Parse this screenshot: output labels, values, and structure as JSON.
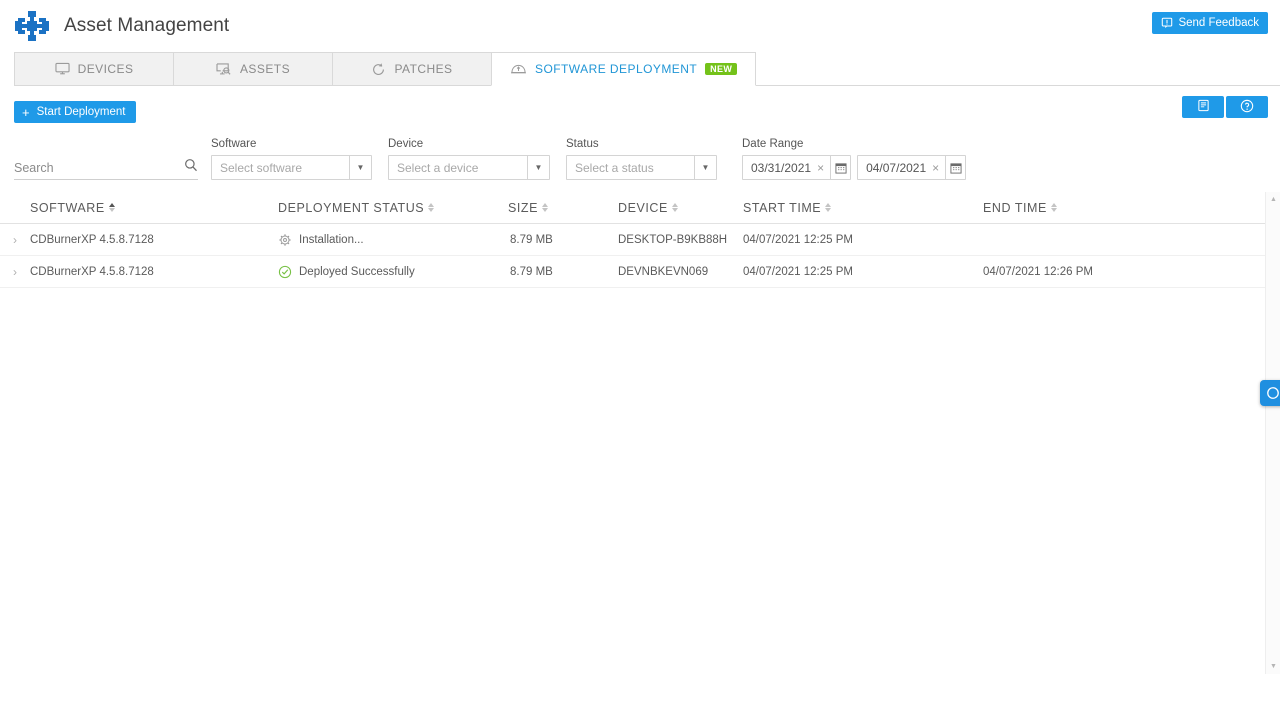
{
  "header": {
    "title": "Asset Management",
    "logo_icon": "grid-puzzle-logo",
    "feedback_label": "Send Feedback",
    "feedback_icon": "feedback-icon"
  },
  "tabs": [
    {
      "label": "DEVICES",
      "icon": "monitor-icon",
      "active": false,
      "badge": ""
    },
    {
      "label": "ASSETS",
      "icon": "monitor-search-icon",
      "active": false,
      "badge": ""
    },
    {
      "label": "PATCHES",
      "icon": "refresh-icon",
      "active": false,
      "badge": ""
    },
    {
      "label": "SOFTWARE DEPLOYMENT",
      "icon": "cloud-deploy-icon",
      "active": true,
      "badge": "NEW"
    }
  ],
  "toolbar": {
    "start_deployment_label": "Start Deployment",
    "plus_glyph": "+",
    "icon_buttons": [
      {
        "icon": "book-icon",
        "name": "documentation-button"
      },
      {
        "icon": "help-circle-icon",
        "name": "help-button"
      }
    ]
  },
  "filters": {
    "search": {
      "label": "Search",
      "placeholder": "Search",
      "value": "",
      "icon": "search-icon"
    },
    "software": {
      "label": "Software",
      "placeholder": "Select software",
      "value": ""
    },
    "device": {
      "label": "Device",
      "placeholder": "Select a device",
      "value": ""
    },
    "status": {
      "label": "Status",
      "placeholder": "Select a status",
      "value": ""
    },
    "date_range": {
      "label": "Date Range",
      "from": "03/31/2021",
      "to": "04/07/2021",
      "clear_glyph": "×",
      "calendar_icon": "calendar-icon"
    }
  },
  "table": {
    "columns": [
      {
        "label": "SOFTWARE",
        "sort": "asc"
      },
      {
        "label": "DEPLOYMENT STATUS",
        "sort": "none"
      },
      {
        "label": "SIZE",
        "sort": "none"
      },
      {
        "label": "DEVICE",
        "sort": "none"
      },
      {
        "label": "START TIME",
        "sort": "none"
      },
      {
        "label": "END TIME",
        "sort": "none"
      }
    ],
    "rows": [
      {
        "expander": "›",
        "software": "CDBurnerXP 4.5.8.7128",
        "status": "Installation...",
        "status_icon": "gear-icon",
        "status_color": "#9b9b9b",
        "size": "8.79 MB",
        "device": "DESKTOP-B9KB88H",
        "start_time": "04/07/2021 12:25 PM",
        "end_time": ""
      },
      {
        "expander": "›",
        "software": "CDBurnerXP 4.5.8.7128",
        "status": "Deployed Successfully",
        "status_icon": "check-circle-icon",
        "status_color": "#76c043",
        "size": "8.79 MB",
        "device": "DEVNBKEVN069",
        "start_time": "04/07/2021 12:25 PM",
        "end_time": "04/07/2021 12:26 PM"
      }
    ]
  },
  "colors": {
    "accent": "#1f9ae8",
    "tab_active_text": "#2196d6",
    "badge_new": "#74c21a",
    "success": "#76c043"
  }
}
